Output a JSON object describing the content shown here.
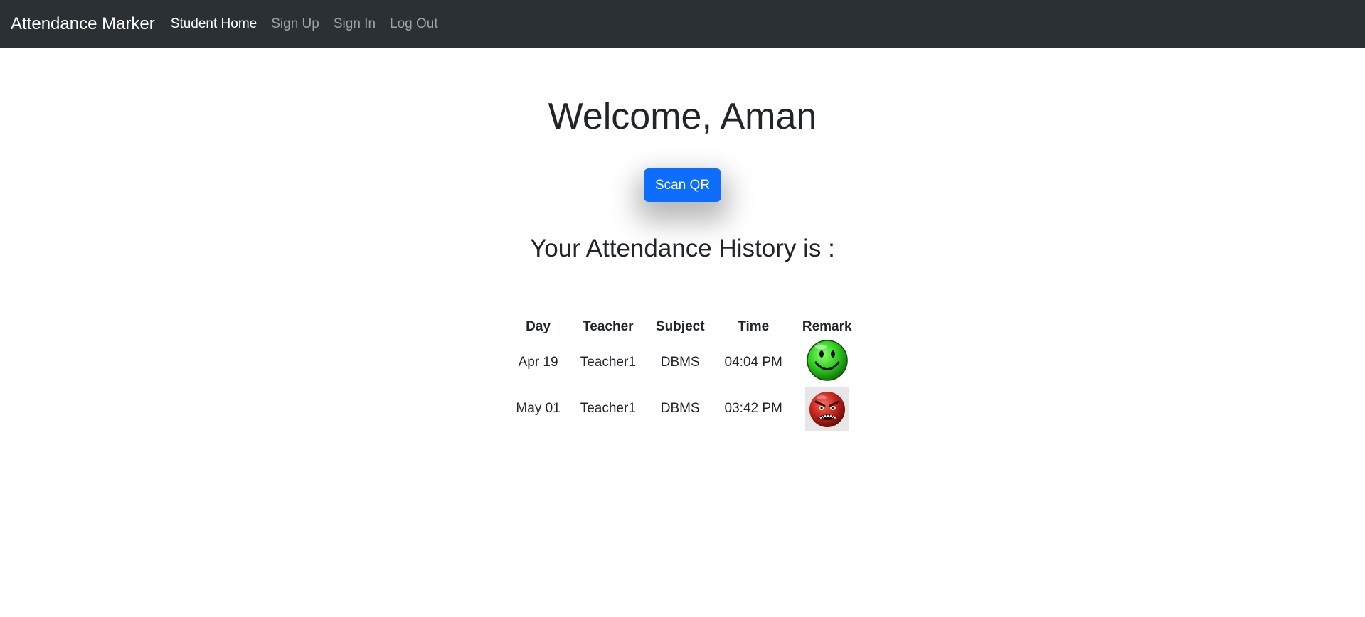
{
  "navbar": {
    "brand": "Attendance Marker",
    "links": [
      {
        "label": "Student Home",
        "active": true
      },
      {
        "label": "Sign Up",
        "active": false
      },
      {
        "label": "Sign In",
        "active": false
      },
      {
        "label": "Log Out",
        "active": false
      }
    ]
  },
  "main": {
    "welcome": "Welcome, Aman",
    "scan_button": "Scan QR",
    "history_title": "Your Attendance History is :"
  },
  "table": {
    "headers": [
      "Day",
      "Teacher",
      "Subject",
      "Time",
      "Remark"
    ],
    "rows": [
      {
        "day": "Apr 19",
        "teacher": "Teacher1",
        "subject": "DBMS",
        "time": "04:04 PM",
        "remark_icon": "happy-face-icon"
      },
      {
        "day": "May 01",
        "teacher": "Teacher1",
        "subject": "DBMS",
        "time": "03:42 PM",
        "remark_icon": "angry-face-icon"
      }
    ]
  },
  "colors": {
    "navbar_bg": "#2b3035",
    "primary": "#0d6efd",
    "happy_green": "#2fd01f",
    "angry_red": "#c8251e"
  }
}
